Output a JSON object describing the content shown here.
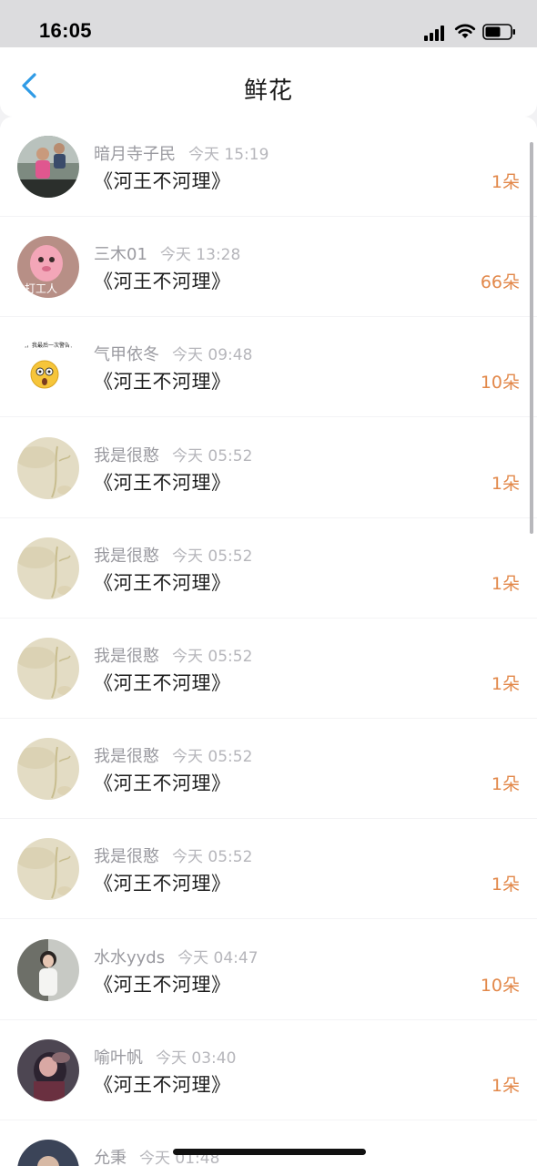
{
  "status_bar": {
    "time": "16:05"
  },
  "nav": {
    "title": "鲜花",
    "back_icon": "chevron-left-icon",
    "accent": "#2f9be6"
  },
  "colors": {
    "count": "#e2884a",
    "name": "#9a9aa0",
    "time": "#b6b6bb"
  },
  "items": [
    {
      "name": "暗月寺子民",
      "time": "今天 15:19",
      "work": "《河王不河理》",
      "count": "1朵",
      "avatar": "photo-cyclists"
    },
    {
      "name": "三木01",
      "time": "今天 13:28",
      "work": "《河王不河理》",
      "count": "66朵",
      "avatar": "pink-cartoon",
      "avatar_text": "打工人"
    },
    {
      "name": "气甲依冬",
      "time": "今天 09:48",
      "work": "《河王不河理》",
      "count": "10朵",
      "avatar": "emoji-meme",
      "avatar_text": "我，我最后一次警告你！"
    },
    {
      "name": "我是很憨",
      "time": "今天 05:52",
      "work": "《河王不河理》",
      "count": "1朵",
      "avatar": "beige-floral"
    },
    {
      "name": "我是很憨",
      "time": "今天 05:52",
      "work": "《河王不河理》",
      "count": "1朵",
      "avatar": "beige-floral"
    },
    {
      "name": "我是很憨",
      "time": "今天 05:52",
      "work": "《河王不河理》",
      "count": "1朵",
      "avatar": "beige-floral"
    },
    {
      "name": "我是很憨",
      "time": "今天 05:52",
      "work": "《河王不河理》",
      "count": "1朵",
      "avatar": "beige-floral"
    },
    {
      "name": "我是很憨",
      "time": "今天 05:52",
      "work": "《河王不河理》",
      "count": "1朵",
      "avatar": "beige-floral"
    },
    {
      "name": "水水yyds",
      "time": "今天 04:47",
      "work": "《河王不河理》",
      "count": "10朵",
      "avatar": "photo-girl"
    },
    {
      "name": "喻叶帆",
      "time": "今天 03:40",
      "work": "《河王不河理》",
      "count": "1朵",
      "avatar": "photo-dark-girl"
    },
    {
      "name": "允秉",
      "time": "今天 01:48",
      "work": "",
      "count": "",
      "avatar": "photo-partial"
    }
  ]
}
